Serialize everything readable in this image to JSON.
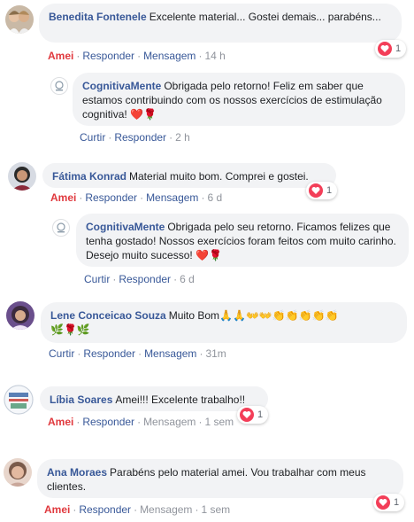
{
  "comments": [
    {
      "author": "Benedita Fontenele",
      "text": "Excelente material... Gostei demais... parabéns...",
      "actions": [
        "Amei",
        "Responder",
        "Mensagem",
        "14 h"
      ],
      "reaction_count": "1",
      "reply": {
        "author": "CognitivaMente",
        "text": "Obrigada pelo retorno! Feliz em saber que estamos contribuindo com os nossos exercícios de estimulação cognitiva!",
        "emojis": "❤️🌹",
        "actions": [
          "Curtir",
          "Responder",
          "2 h"
        ]
      }
    },
    {
      "author": "Fátima Konrad",
      "text": "Material muito bom. Comprei e gostei.",
      "actions": [
        "Amei",
        "Responder",
        "Mensagem",
        "6 d"
      ],
      "reaction_count": "1",
      "reply": {
        "author": "CognitivaMente",
        "text": "Obrigada pelo seu retorno. Ficamos felizes que tenha gostado! Nossos exercícios foram feitos com muito carinho. Desejo muito sucesso!",
        "emojis": "❤️🌹",
        "actions": [
          "Curtir",
          "Responder",
          "6 d"
        ]
      }
    },
    {
      "author": "Lene Conceicao Souza",
      "text": "Muito Bom",
      "emojis_line1": "🙏🙏👐👐👏👏👏👏👏",
      "emojis_line2": "🌿🌹🌿",
      "actions": [
        "Curtir",
        "Responder",
        "Mensagem",
        "31m"
      ]
    },
    {
      "author": "Líbia Soares",
      "text": "Amei!!! Excelente trabalho!!",
      "actions": [
        "Amei",
        "Responder",
        "Mensagem",
        "1 sem"
      ],
      "reaction_count": "1"
    },
    {
      "author": "Ana Moraes",
      "text": "Parabéns pelo material amei. Vou trabalhar com meus clientes.",
      "actions": [
        "Amei",
        "Responder",
        "Mensagem",
        "1 sem"
      ],
      "reaction_count": "1"
    }
  ],
  "colors": {
    "author": "#385898",
    "liked": "#e0393e",
    "bubble": "#f2f3f5",
    "heart": "#f33e58"
  }
}
